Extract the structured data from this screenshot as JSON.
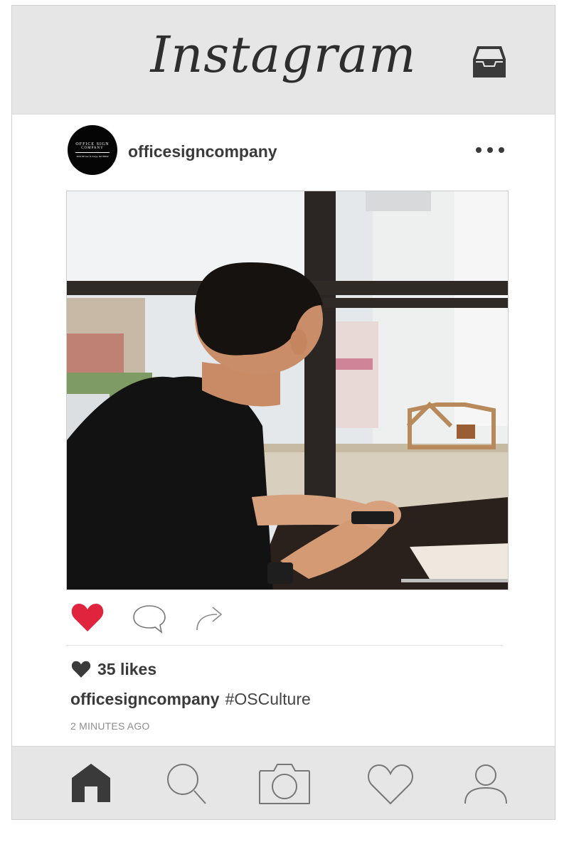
{
  "app": {
    "title": "Instagram"
  },
  "post": {
    "username": "officesigncompany",
    "avatar": {
      "line1": "OFFICE SIGN",
      "line2": "COMPANY",
      "line3": "3013 NP Ave N, Fargo, ND 58102"
    },
    "photo_alt": "man at window",
    "likes_text": "35 likes",
    "caption": {
      "username": "officesigncompany",
      "text": "#OSCulture"
    },
    "timestamp": "2 MINUTES AGO"
  },
  "icons": {
    "inbox": "inbox-icon",
    "more": "more-options-icon",
    "like": "heart-filled-icon",
    "comment": "comment-icon",
    "share": "share-arrow-icon",
    "nav": [
      "home-icon",
      "search-icon",
      "camera-icon",
      "heart-icon",
      "profile-icon"
    ]
  },
  "colors": {
    "like": "#e0243e",
    "bar": "#e6e6e6",
    "text": "#3a3a3a"
  }
}
